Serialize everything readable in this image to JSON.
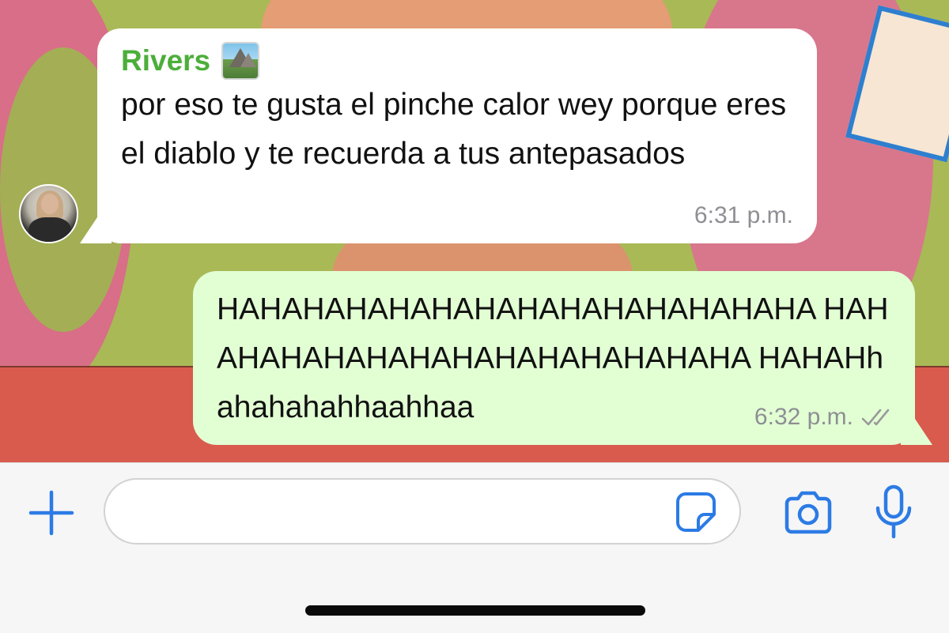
{
  "conversation": {
    "incoming": {
      "sender": "Rivers",
      "sender_emoji": "national-park-emoji",
      "text": "por eso te gusta el pinche calor wey porque eres el diablo y te recuerda a tus antepasados",
      "time": "6:31 p.m."
    },
    "outgoing": {
      "text": "HAHAHAHAHAHAHAHAHAHAHAHAHAHA HAHAHAHAHAHAHAHAHAHAHAHAHAHA HAHAHhahahahahhaahhaa",
      "time": "6:32 p.m.",
      "status": "delivered-double-check"
    }
  },
  "composer": {
    "input_value": "",
    "attach_icon": "plus-icon",
    "sticker_icon": "sticker-icon",
    "camera_icon": "camera-icon",
    "mic_icon": "microphone-icon"
  },
  "colors": {
    "accent": "#2c7be5",
    "sender_name": "#4cae3a",
    "outgoing_bubble": "#e2ffd4",
    "incoming_bubble": "#ffffff",
    "timestamp": "#8e8e93"
  }
}
